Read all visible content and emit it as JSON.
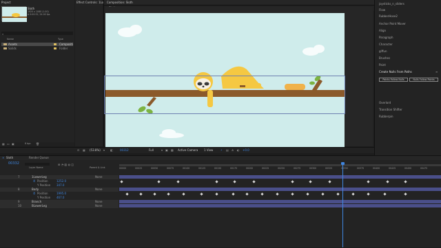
{
  "project": {
    "tab_label": "Project",
    "effect_tab": "Effect Controls: 1LowerLeg",
    "thumb_name": "Sloth",
    "thumb_info1": "1920 x 1080 (1.00)",
    "thumb_info2": "Δ 0:00:32, 24.00 fps",
    "header_name": "Name",
    "header_type": "Type",
    "rows": [
      {
        "name": "Assets",
        "type": "Compositi",
        "selected": true,
        "swatch": "#e0c060"
      },
      {
        "name": "Solids",
        "type": "Folder",
        "selected": false,
        "swatch": "#e0c060"
      }
    ]
  },
  "viewer": {
    "tab_label": "Composition: Sloth",
    "sub_tab": "Sloth",
    "zoom": "(53.8%)",
    "timecode": "00312",
    "quality": "Full",
    "camera": "Active Camera",
    "views": "1 View",
    "offset": "+0.0"
  },
  "right_panel": {
    "items_top": [
      "joysticks_n_sliders",
      "Flow",
      "RubberHose2",
      "Anchor Point Mover",
      "Align",
      "Paragraph",
      "Character",
      "giffun",
      "Brushes",
      "Paint"
    ],
    "script_title": "Create Nulls From Paths",
    "buttons": [
      "Points Follow Nulls",
      "Nulls Follow Points"
    ],
    "items_bottom": [
      "Overlord",
      "Transition Shifter",
      "Rubberpin"
    ]
  },
  "timeline": {
    "tab1": "Sloth",
    "tab2": "Render Queue",
    "timecode": "00332",
    "col_layer_name": "Layer Name",
    "col_parent": "Parent & Link",
    "ruler": [
      "00000",
      "00025",
      "00050",
      "00075",
      "00100",
      "00125",
      "00150",
      "00175",
      "00200",
      "00225",
      "00250",
      "00275",
      "00300",
      "00325",
      "00350",
      "00375",
      "00400",
      "00425",
      "00450",
      "00475"
    ],
    "rows": [
      {
        "num": "7",
        "name": "1LowerLeg",
        "parent": "None",
        "type": "layer"
      },
      {
        "num": "",
        "name": "Position",
        "value": "1252.0",
        "parent": "",
        "type": "prop"
      },
      {
        "num": "",
        "name": "Y Position",
        "value": "347.0",
        "parent": "",
        "type": "prop"
      },
      {
        "num": "8",
        "name": "Body",
        "parent": "None",
        "type": "layer"
      },
      {
        "num": "",
        "name": "Position",
        "value": "1995.0",
        "parent": "",
        "type": "prop"
      },
      {
        "num": "",
        "name": "Y Position",
        "value": "467.0",
        "parent": "",
        "type": "prop"
      },
      {
        "num": "9",
        "name": "Branch",
        "parent": "None",
        "type": "layer"
      },
      {
        "num": "10",
        "name": "BLowerLeg",
        "parent": "None",
        "type": "layer"
      }
    ]
  },
  "colors": {
    "accent": "#3f86e0",
    "comp_bg": "#cfeceb",
    "sloth": "#f5c842",
    "branch": "#8b5a2b",
    "leaf": "#7cb342"
  }
}
